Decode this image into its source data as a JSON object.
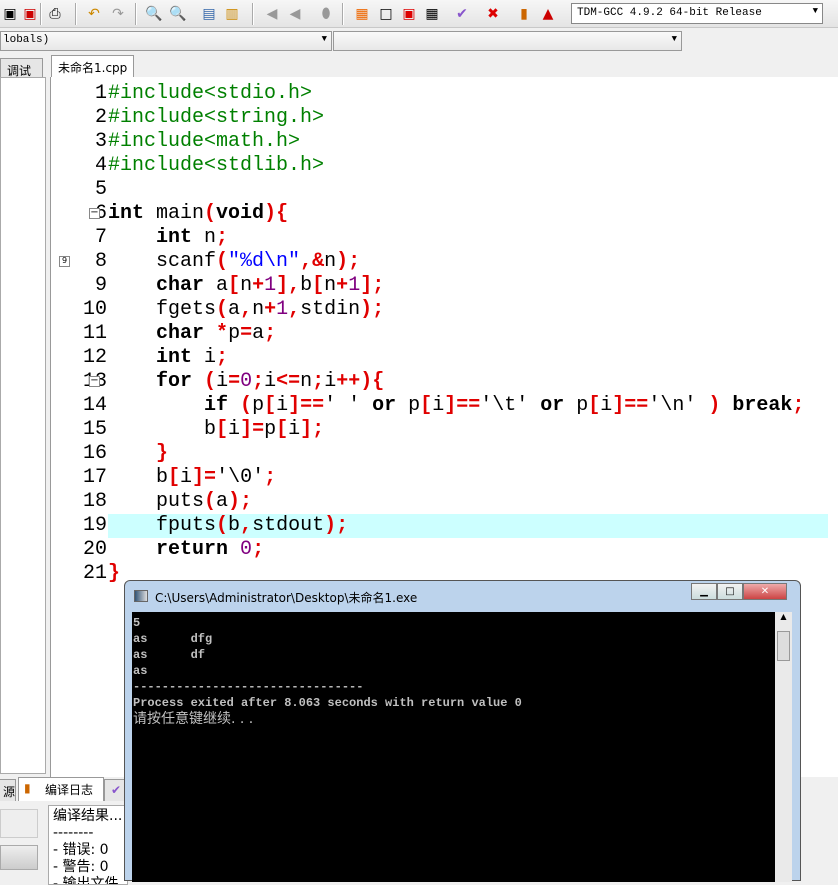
{
  "toolbar": {
    "compiler": "TDM-GCC 4.9.2 64-bit Release"
  },
  "scope_combo": {
    "value": "lobals)"
  },
  "tabs": {
    "left": "调试",
    "file": "未命名1.cpp"
  },
  "code": [
    [
      [
        "p",
        "#include<stdio.h>"
      ]
    ],
    [
      [
        "p",
        "#include<string.h>"
      ]
    ],
    [
      [
        "p",
        "#include<math.h>"
      ]
    ],
    [
      [
        "p",
        "#include<stdlib.h>"
      ]
    ],
    [],
    [
      [
        "k",
        "int"
      ],
      [
        "d",
        " main"
      ],
      [
        "s",
        "("
      ],
      [
        "k",
        "void"
      ],
      [
        "s",
        "){"
      ]
    ],
    [
      [
        "d",
        "    "
      ],
      [
        "k",
        "int"
      ],
      [
        "d",
        " n"
      ],
      [
        "s",
        ";"
      ]
    ],
    [
      [
        "d",
        "    scanf"
      ],
      [
        "s",
        "("
      ],
      [
        "str",
        "\"%d\\n\""
      ],
      [
        "s",
        ","
      ],
      [
        "s",
        "&"
      ],
      [
        "d",
        "n"
      ],
      [
        "s",
        ");"
      ]
    ],
    [
      [
        "d",
        "    "
      ],
      [
        "k",
        "char"
      ],
      [
        "d",
        " a"
      ],
      [
        "s",
        "["
      ],
      [
        "d",
        "n"
      ],
      [
        "s",
        "+"
      ],
      [
        "n",
        "1"
      ],
      [
        "s",
        "],"
      ],
      [
        "d",
        "b"
      ],
      [
        "s",
        "["
      ],
      [
        "d",
        "n"
      ],
      [
        "s",
        "+"
      ],
      [
        "n",
        "1"
      ],
      [
        "s",
        "];"
      ]
    ],
    [
      [
        "d",
        "    fgets"
      ],
      [
        "s",
        "("
      ],
      [
        "d",
        "a"
      ],
      [
        "s",
        ","
      ],
      [
        "d",
        "n"
      ],
      [
        "s",
        "+"
      ],
      [
        "n",
        "1"
      ],
      [
        "s",
        ","
      ],
      [
        "d",
        "stdin"
      ],
      [
        "s",
        ");"
      ]
    ],
    [
      [
        "d",
        "    "
      ],
      [
        "k",
        "char"
      ],
      [
        "d",
        " "
      ],
      [
        "s",
        "*"
      ],
      [
        "d",
        "p"
      ],
      [
        "s",
        "="
      ],
      [
        "d",
        "a"
      ],
      [
        "s",
        ";"
      ]
    ],
    [
      [
        "d",
        "    "
      ],
      [
        "k",
        "int"
      ],
      [
        "d",
        " i"
      ],
      [
        "s",
        ";"
      ]
    ],
    [
      [
        "d",
        "    "
      ],
      [
        "k",
        "for"
      ],
      [
        "d",
        " "
      ],
      [
        "s",
        "("
      ],
      [
        "d",
        "i"
      ],
      [
        "s",
        "="
      ],
      [
        "n",
        "0"
      ],
      [
        "s",
        ";"
      ],
      [
        "d",
        "i"
      ],
      [
        "s",
        "<="
      ],
      [
        "d",
        "n"
      ],
      [
        "s",
        ";"
      ],
      [
        "d",
        "i"
      ],
      [
        "s",
        "++){"
      ]
    ],
    [
      [
        "d",
        "        "
      ],
      [
        "k",
        "if"
      ],
      [
        "d",
        " "
      ],
      [
        "s",
        "("
      ],
      [
        "d",
        "p"
      ],
      [
        "s",
        "["
      ],
      [
        "d",
        "i"
      ],
      [
        "s",
        "]=="
      ],
      [
        "d",
        "' ' "
      ],
      [
        "k",
        "or"
      ],
      [
        "d",
        " p"
      ],
      [
        "s",
        "["
      ],
      [
        "d",
        "i"
      ],
      [
        "s",
        "]=="
      ],
      [
        "d",
        "'\\t' "
      ],
      [
        "k",
        "or"
      ],
      [
        "d",
        " p"
      ],
      [
        "s",
        "["
      ],
      [
        "d",
        "i"
      ],
      [
        "s",
        "]=="
      ],
      [
        "d",
        "'\\n' "
      ],
      [
        "s",
        ")"
      ],
      [
        "d",
        " "
      ],
      [
        "k",
        "break"
      ],
      [
        "s",
        ";"
      ]
    ],
    [
      [
        "d",
        "        b"
      ],
      [
        "s",
        "["
      ],
      [
        "d",
        "i"
      ],
      [
        "s",
        "]="
      ],
      [
        "d",
        "p"
      ],
      [
        "s",
        "["
      ],
      [
        "d",
        "i"
      ],
      [
        "s",
        "];"
      ]
    ],
    [
      [
        "d",
        "    "
      ],
      [
        "s",
        "}"
      ]
    ],
    [
      [
        "d",
        "    b"
      ],
      [
        "s",
        "["
      ],
      [
        "d",
        "i"
      ],
      [
        "s",
        "]="
      ],
      [
        "d",
        "'\\0'"
      ],
      [
        "s",
        ";"
      ]
    ],
    [
      [
        "d",
        "    puts"
      ],
      [
        "s",
        "("
      ],
      [
        "d",
        "a"
      ],
      [
        "s",
        ");"
      ]
    ],
    [
      [
        "d",
        "    fputs"
      ],
      [
        "s",
        "("
      ],
      [
        "d",
        "b"
      ],
      [
        "s",
        ","
      ],
      [
        "d",
        "stdout"
      ],
      [
        "s",
        ");"
      ]
    ],
    [
      [
        "d",
        "    "
      ],
      [
        "k",
        "return"
      ],
      [
        "d",
        " "
      ],
      [
        "n",
        "0"
      ],
      [
        "s",
        ";"
      ]
    ],
    [
      [
        "s",
        "}"
      ]
    ]
  ],
  "highlighted_line": 19,
  "bottom": {
    "tab_resources": "源",
    "tab_compile_log": "编译日志",
    "log": [
      "编译结果...",
      "--------",
      "- 错误: 0",
      "- 警告: 0",
      "- 输出文件"
    ]
  },
  "console": {
    "title": "C:\\Users\\Administrator\\Desktop\\未命名1.exe",
    "output": [
      "5",
      "as      dfg",
      "as      df",
      "as",
      "--------------------------------",
      "Process exited after 8.063 seconds with return value 0",
      "请按任意键继续. . ."
    ]
  },
  "colors": {
    "preprocessor": "#008000",
    "symbol": "#e00000",
    "number": "#800080",
    "string": "#0000ff",
    "highlight": "#ccffff"
  }
}
